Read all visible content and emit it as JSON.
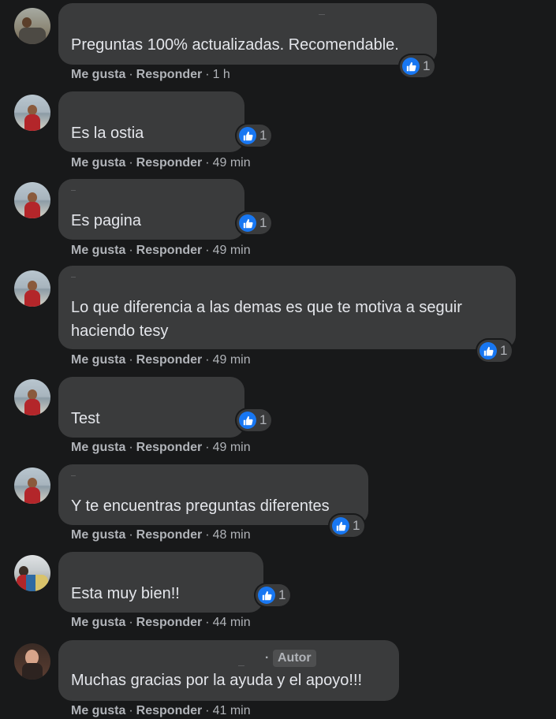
{
  "actions": {
    "like_label": "Me gusta",
    "reply_label": "Responder",
    "separator": "·"
  },
  "colors": {
    "background": "#18191a",
    "bubble": "#3a3b3c",
    "like_blue": "#1877f2",
    "text": "#e4e6eb",
    "muted": "#b0b3b8"
  },
  "comments": [
    {
      "text": "Preguntas 100% actualizadas. Recomendable.",
      "reactions": "1",
      "time": "1 h",
      "avatar_icon": "avatar-photo"
    },
    {
      "text": "Es la ostia",
      "reactions": "1",
      "time": "49 min",
      "avatar_icon": "avatar-photo"
    },
    {
      "text": "Es pagina",
      "reactions": "1",
      "time": "49 min",
      "avatar_icon": "avatar-photo"
    },
    {
      "text": "Lo que diferencia a las demas es que te motiva a seguir haciendo tesy",
      "reactions": "1",
      "time": "49 min",
      "avatar_icon": "avatar-photo"
    },
    {
      "text": "Test",
      "reactions": "1",
      "time": "49 min",
      "avatar_icon": "avatar-photo"
    },
    {
      "text": "Y te encuentras preguntas diferentes",
      "reactions": "1",
      "time": "48 min",
      "avatar_icon": "avatar-photo"
    },
    {
      "text": "Esta muy bien!!",
      "reactions": "1",
      "time": "44 min",
      "avatar_icon": "avatar-photo"
    },
    {
      "text": "Muchas gracias por la ayuda y el apoyo!!!",
      "time": "41 min",
      "author_badge": "Autor",
      "name_suffix": ".",
      "avatar_icon": "avatar-photo"
    }
  ]
}
